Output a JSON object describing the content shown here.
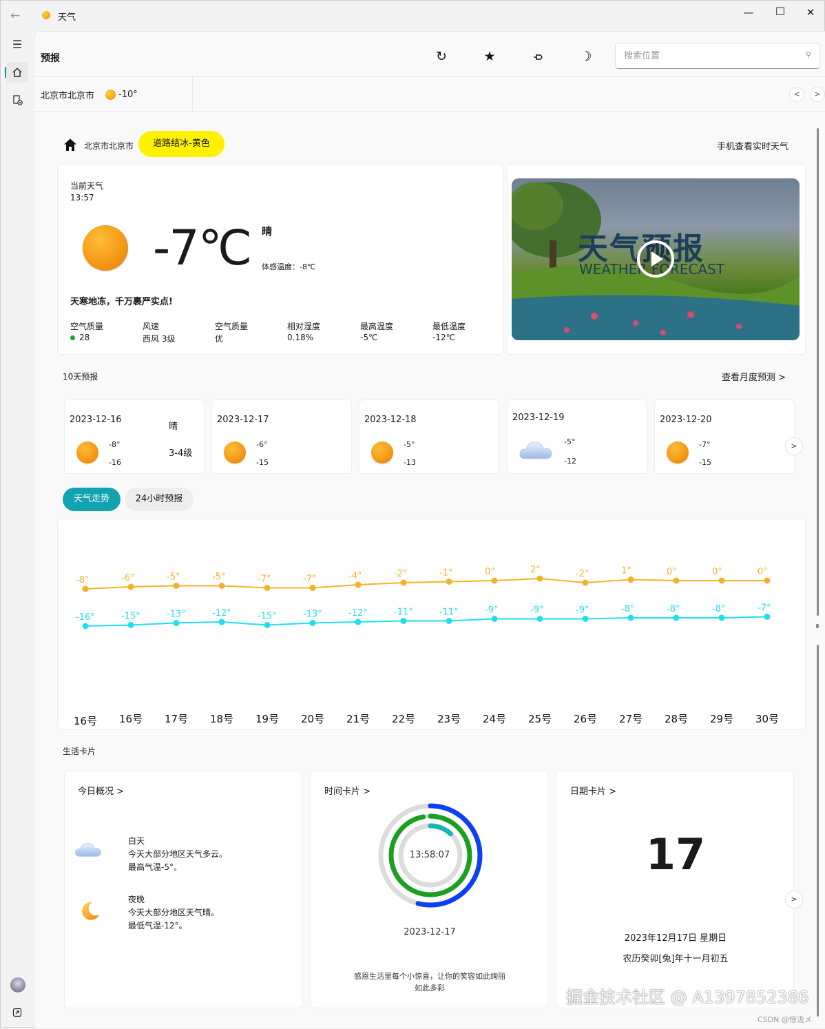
{
  "window": {
    "title": "天气"
  },
  "header": {
    "page_title": "预报",
    "search_placeholder": "搜索位置"
  },
  "location_tab": {
    "city": "北京市北京市",
    "temp": "-10°"
  },
  "overview": {
    "city": "北京市北京市",
    "alert": "道路结冰-黄色",
    "mobile_link": "手机查看实时天气",
    "current_label": "当前天气",
    "time": "13:57",
    "temperature": "-7℃",
    "condition": "晴",
    "feels_like": "体感温度：-8℃",
    "tip": "天寒地冻，千万裹严实点!",
    "stats": [
      {
        "label": "空气质量",
        "value": "28"
      },
      {
        "label": "风速",
        "value": "西风 3级"
      },
      {
        "label": "空气质量",
        "value": "优"
      },
      {
        "label": "相对湿度",
        "value": "0.18%"
      },
      {
        "label": "最高温度",
        "value": "-5℃"
      },
      {
        "label": "最低温度",
        "value": "-12℃"
      }
    ],
    "video_title": "天气预报",
    "video_subtitle": "WEATHER FORECAST"
  },
  "ten_day": {
    "title": "10天预报",
    "monthly_link": "查看月度预测 >",
    "days": [
      {
        "date": "2023-12-16",
        "high": "-8°",
        "low": "-16",
        "icon": "sun-icon",
        "cond": "晴",
        "wind": "3-4级"
      },
      {
        "date": "2023-12-17",
        "high": "-6°",
        "low": "-15",
        "icon": "sun-icon"
      },
      {
        "date": "2023-12-18",
        "high": "-5°",
        "low": "-13",
        "icon": "sun-icon"
      },
      {
        "date": "2023-12-19",
        "high": "-5°",
        "low": "-12",
        "icon": "cloud-icon"
      },
      {
        "date": "2023-12-20",
        "high": "-7°",
        "low": "-15",
        "icon": "sun-icon"
      }
    ],
    "next": ">"
  },
  "trend_tabs": {
    "active": "天气走势",
    "other": "24小时预报"
  },
  "chart_data": {
    "type": "line",
    "categories": [
      "16号",
      "16号",
      "17号",
      "18号",
      "19号",
      "20号",
      "21号",
      "22号",
      "23号",
      "24号",
      "25号",
      "26号",
      "27号",
      "28号",
      "29号",
      "30号"
    ],
    "series": [
      {
        "color": "#f5b12a",
        "values": [
          -8,
          -6,
          -5,
          -5,
          -7,
          -7,
          -4,
          -2,
          -1,
          0,
          2,
          -2,
          1,
          0,
          0,
          0
        ],
        "labels": [
          "-8°",
          "-6°",
          "-5°",
          "-5°",
          "-7°",
          "-7°",
          "-4°",
          "-2°",
          "-1°",
          "0°",
          "2°",
          "-2°",
          "1°",
          "0°",
          "0°",
          "0°"
        ]
      },
      {
        "color": "#22ddf0",
        "values": [
          -16,
          -15,
          -13,
          -12,
          -15,
          -13,
          -12,
          -11,
          -11,
          -9,
          -9,
          -9,
          -8,
          -8,
          -8,
          -7
        ],
        "labels": [
          "-16°",
          "-15°",
          "-13°",
          "-12°",
          "-15°",
          "-13°",
          "-12°",
          "-11°",
          "-11°",
          "-9°",
          "-9°",
          "-9°",
          "-8°",
          "-8°",
          "-8°",
          "-7°"
        ]
      }
    ],
    "grid": false,
    "title": "",
    "xlabel": "",
    "ylabel": ""
  },
  "life": {
    "title": "生活卡片",
    "today": {
      "title": "今日概况 >",
      "day_label": "白天",
      "day_text1": "今天大部分地区天气多云。",
      "day_text2": "最高气温-5°。",
      "night_label": "夜晚",
      "night_text1": "今天大部分地区天气晴。",
      "night_text2": "最低气温-12°。"
    },
    "time": {
      "title": "时间卡片 >",
      "clock": "13:58:07",
      "date": "2023-12-17",
      "quote1": "感恩生活里每个小惊喜，让你的笑容如此绚丽",
      "quote2": "如此多彩",
      "rings": {
        "hours": 0.54,
        "minutes": 0.97,
        "seconds": 0.12
      }
    },
    "date": {
      "title": "日期卡片 >",
      "day": "17",
      "full": "2023年12月17日 星期日",
      "lunar": "农历癸卯[兔]年十一月初五",
      "next": ">"
    }
  },
  "watermark": {
    "main": "掘金技术社区 @ A1397852386",
    "small": "CSDN @惊泷メ"
  },
  "colors": {
    "accent": "#11a3b0",
    "alert": "#fff200",
    "high_line": "#f5b12a",
    "low_line": "#22ddf0"
  }
}
